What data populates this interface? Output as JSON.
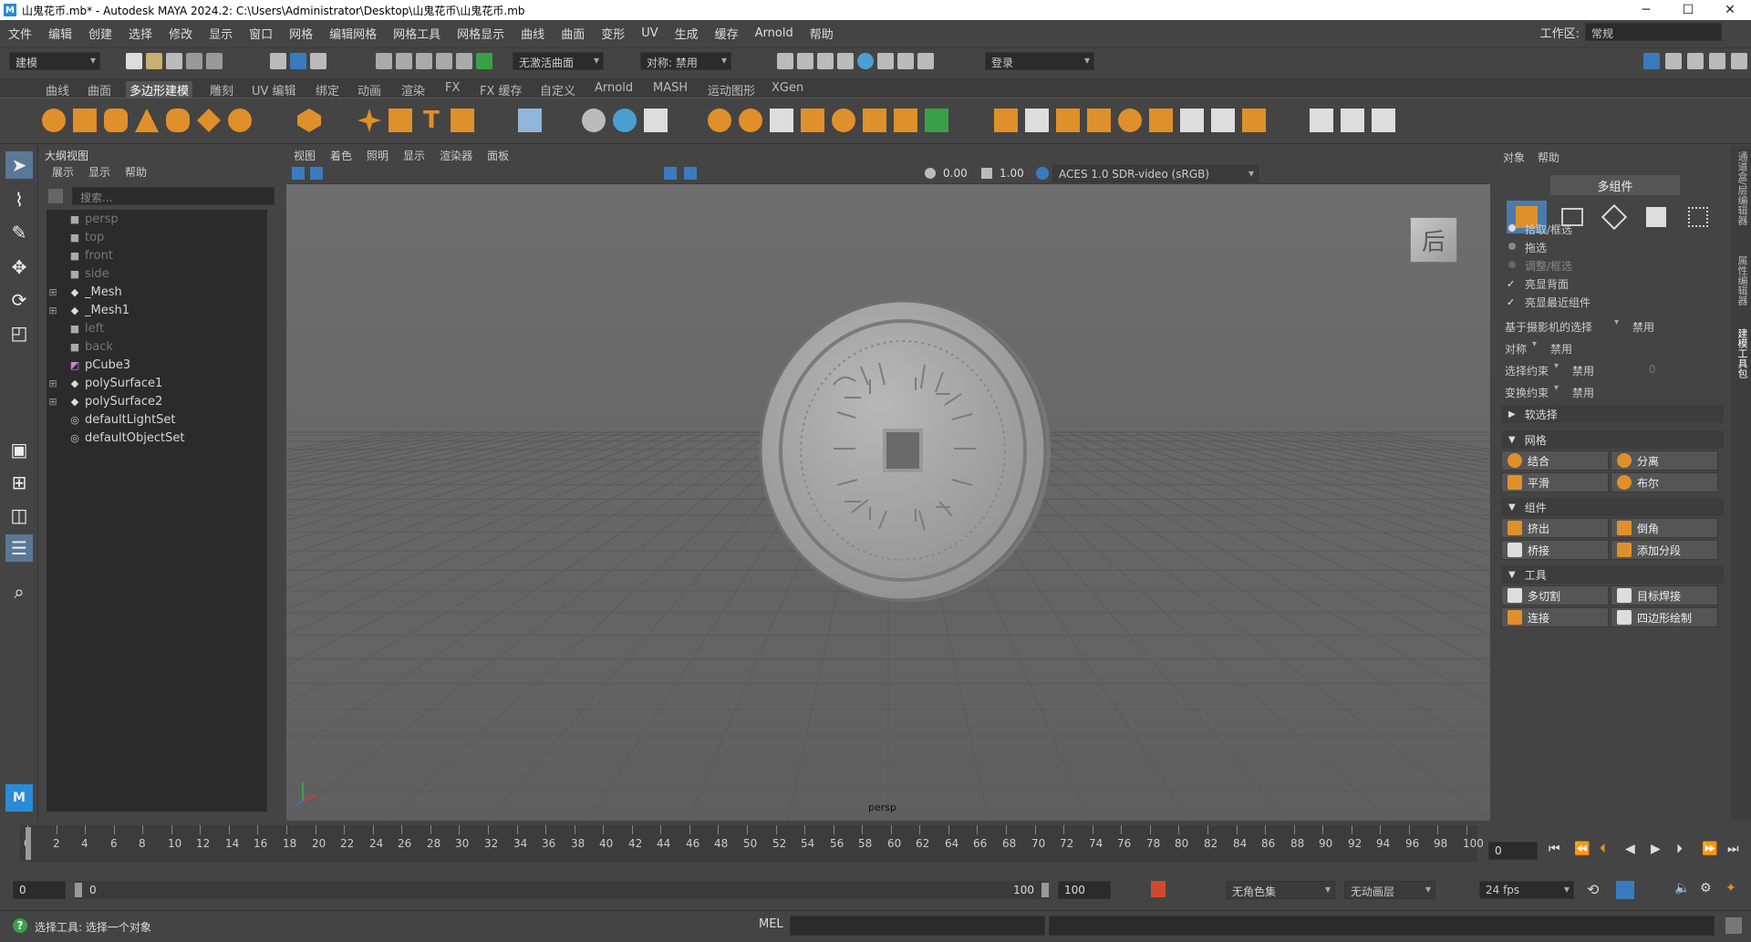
{
  "window": {
    "title": "山鬼花币.mb* - Autodesk MAYA 2024.2: C:\\Users\\Administrator\\Desktop\\山鬼花币\\山鬼花币.mb",
    "min": "─",
    "max": "☐",
    "close": "✕"
  },
  "menu": [
    "文件",
    "编辑",
    "创建",
    "选择",
    "修改",
    "显示",
    "窗口",
    "网格",
    "编辑网格",
    "网格工具",
    "网格显示",
    "曲线",
    "曲面",
    "变形",
    "UV",
    "生成",
    "缓存",
    "Arnold",
    "帮助"
  ],
  "workspace": {
    "label": "工作区:",
    "value": "常规"
  },
  "statusline": {
    "mode": "建模",
    "live": "无激活曲面",
    "symmetry": "对称: 禁用",
    "login": "登录"
  },
  "shelf_tabs": [
    "曲线",
    "曲面",
    "多边形建模",
    "雕刻",
    "UV 编辑",
    "绑定",
    "动画",
    "渲染",
    "FX",
    "FX 缓存",
    "自定义",
    "Arnold",
    "MASH",
    "运动图形",
    "XGen"
  ],
  "shelf_active": "多边形建模",
  "outliner": {
    "title": "大纲视图",
    "menus": [
      "展示",
      "显示",
      "帮助"
    ],
    "search_placeholder": "搜索...",
    "items": [
      {
        "label": "persp",
        "type": "camera",
        "dim": true,
        "exp": false
      },
      {
        "label": "top",
        "type": "camera",
        "dim": true,
        "exp": false
      },
      {
        "label": "front",
        "type": "camera",
        "dim": true,
        "exp": false
      },
      {
        "label": "side",
        "type": "camera",
        "dim": true,
        "exp": false
      },
      {
        "label": "_Mesh",
        "type": "group",
        "dim": false,
        "exp": true
      },
      {
        "label": "_Mesh1",
        "type": "group",
        "dim": false,
        "exp": true
      },
      {
        "label": "left",
        "type": "camera",
        "dim": true,
        "exp": false
      },
      {
        "label": "back",
        "type": "camera",
        "dim": true,
        "exp": false
      },
      {
        "label": "pCube3",
        "type": "mesh",
        "dim": false,
        "exp": false
      },
      {
        "label": "polySurface1",
        "type": "group",
        "dim": false,
        "exp": true
      },
      {
        "label": "polySurface2",
        "type": "group",
        "dim": false,
        "exp": true
      },
      {
        "label": "defaultLightSet",
        "type": "set",
        "dim": false,
        "exp": false
      },
      {
        "label": "defaultObjectSet",
        "type": "set",
        "dim": false,
        "exp": false
      }
    ]
  },
  "viewport": {
    "menus": [
      "视图",
      "着色",
      "照明",
      "显示",
      "渲染器",
      "面板"
    ],
    "exposure": "0.00",
    "gamma": "1.00",
    "colorspace": "ACES 1.0 SDR-video (sRGB)",
    "viewcube": "后",
    "camera": "persp"
  },
  "modeling": {
    "tabs": [
      "对象",
      "帮助"
    ],
    "header": "多组件",
    "options": [
      {
        "label": "拾取/框选",
        "kind": "radio",
        "on": true
      },
      {
        "label": "拖选",
        "kind": "radio",
        "on": false
      },
      {
        "label": "调整/框选",
        "kind": "radio",
        "on": false,
        "dim": true
      },
      {
        "label": "亮显背面",
        "kind": "check",
        "on": true
      },
      {
        "label": "亮显最近组件",
        "kind": "check",
        "on": true
      }
    ],
    "rows": [
      {
        "label": "基于摄影机的选择",
        "value": "禁用"
      },
      {
        "label": "对称",
        "value": "禁用"
      },
      {
        "label": "选择约束",
        "value": "禁用",
        "extra": "0"
      },
      {
        "label": "变换约束",
        "value": "禁用"
      }
    ],
    "soft": "软选择",
    "sections": [
      {
        "title": "网格",
        "buttons": [
          "结合",
          "分离",
          "平滑",
          "布尔"
        ]
      },
      {
        "title": "组件",
        "buttons": [
          "挤出",
          "倒角",
          "桥接",
          "添加分段"
        ]
      },
      {
        "title": "工具",
        "buttons": [
          "多切割",
          "目标焊接",
          "连接",
          "四边形绘制"
        ]
      }
    ]
  },
  "side_tabs": [
    "通道盒/层编辑器",
    "属性编辑器",
    "建模工具包"
  ],
  "timeline": {
    "ticks": [
      "0",
      "2",
      "4",
      "6",
      "8",
      "10",
      "12",
      "14",
      "16",
      "18",
      "20",
      "22",
      "24",
      "26",
      "28",
      "30",
      "32",
      "34",
      "36",
      "38",
      "40",
      "42",
      "44",
      "46",
      "48",
      "50",
      "52",
      "54",
      "56",
      "58",
      "60",
      "62",
      "64",
      "66",
      "68",
      "70",
      "72",
      "74",
      "76",
      "78",
      "80",
      "82",
      "84",
      "86",
      "88",
      "90",
      "92",
      "94",
      "96",
      "98",
      "100"
    ],
    "current": "0"
  },
  "range": {
    "start": "0",
    "inner_start": "0",
    "inner_end": "100",
    "end": "100",
    "charset": "无角色集",
    "layer": "无动画层",
    "fps": "24 fps"
  },
  "cmdline": {
    "help": "选择工具: 选择一个对象",
    "lang": "MEL"
  }
}
